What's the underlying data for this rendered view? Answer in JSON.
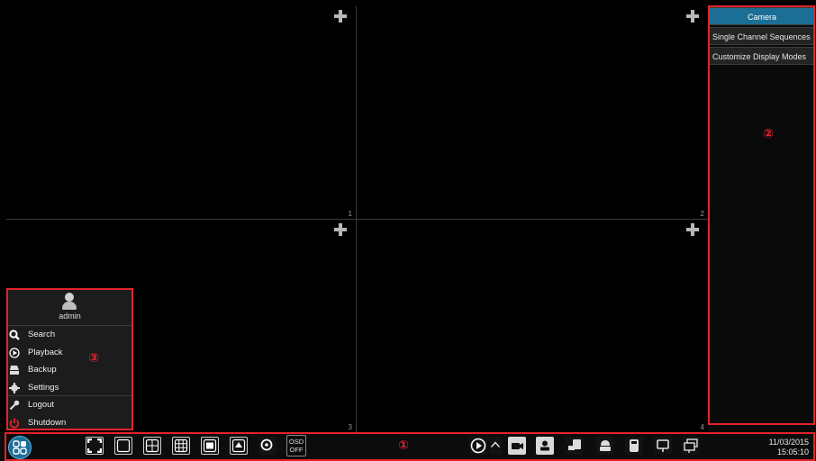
{
  "cells": [
    {
      "number": "1"
    },
    {
      "number": "2"
    },
    {
      "number": "3"
    },
    {
      "number": "4"
    }
  ],
  "side_panel": {
    "tabs": [
      "Camera",
      "Single Channel Sequences",
      "Customize Display Modes"
    ],
    "active_tab": "Camera",
    "marker": "②"
  },
  "start_menu": {
    "username": "admin",
    "marker": "③",
    "items": [
      {
        "label": "Search",
        "icon": "search-icon"
      },
      {
        "label": "Playback",
        "icon": "play-icon"
      },
      {
        "label": "Backup",
        "icon": "backup-icon"
      },
      {
        "label": "Settings",
        "icon": "gear-icon"
      },
      {
        "label": "Logout",
        "icon": "key-icon"
      },
      {
        "label": "Shutdown",
        "icon": "power-icon"
      }
    ]
  },
  "toolbar": {
    "marker": "①",
    "osd_line1": "OSD",
    "osd_line2": "OFF",
    "date": "11/03/2015",
    "time": "15:05:10",
    "accent_color": "#1b6e95",
    "annotation_color": "#e2232a"
  }
}
